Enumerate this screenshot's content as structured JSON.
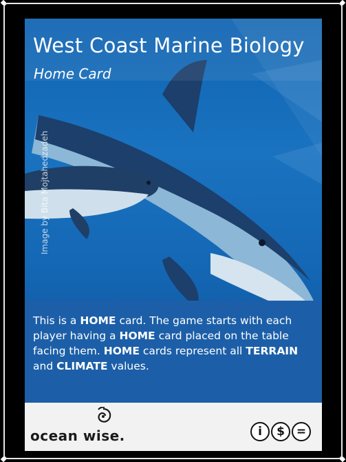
{
  "card": {
    "title": "West Coast Marine Biology",
    "subtitle": "Home Card",
    "image_credit": "Image by Bita Mojtahedzadeh",
    "description_parts": [
      "This is a ",
      "HOME",
      " card. The game starts with each player having a ",
      "HOME",
      " card placed on the table facing them.  ",
      "HOME",
      " cards represent all ",
      "TERRAIN",
      " and ",
      "CLIMATE",
      " values."
    ]
  },
  "footer": {
    "logo_text": "ocean wise.",
    "license_badges": [
      "i",
      "$",
      "="
    ]
  },
  "colors": {
    "background": "#000000",
    "ocean_blue": "#1a73c0",
    "panel_blue": "#1c5fa8",
    "footer_bg": "#f2f2f2"
  },
  "icons": [
    "ocean-wise-logo-icon",
    "attribution-icon",
    "noncommercial-icon",
    "no-derivatives-icon"
  ]
}
